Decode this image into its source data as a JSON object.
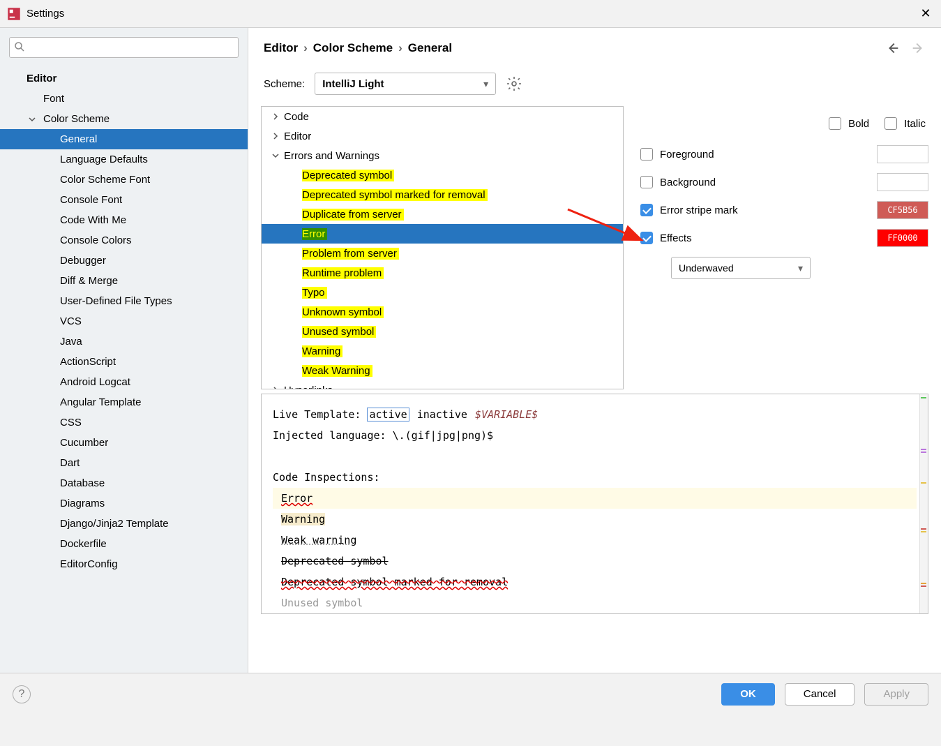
{
  "window": {
    "title": "Settings"
  },
  "breadcrumb": [
    "Editor",
    "Color Scheme",
    "General"
  ],
  "scheme": {
    "label": "Scheme:",
    "value": "IntelliJ Light"
  },
  "sidebar": {
    "root": "Editor",
    "font": "Font",
    "color_scheme": "Color Scheme",
    "items": [
      "General",
      "Language Defaults",
      "Color Scheme Font",
      "Console Font",
      "Code With Me",
      "Console Colors",
      "Debugger",
      "Diff & Merge",
      "User-Defined File Types",
      "VCS",
      "Java",
      "ActionScript",
      "Android Logcat",
      "Angular Template",
      "CSS",
      "Cucumber",
      "Dart",
      "Database",
      "Diagrams",
      "Django/Jinja2 Template",
      "Dockerfile",
      "EditorConfig"
    ],
    "selected": "General"
  },
  "tree": {
    "top": [
      "Code",
      "Editor"
    ],
    "group": "Errors and Warnings",
    "children": [
      "Deprecated symbol",
      "Deprecated symbol marked for removal",
      "Duplicate from server",
      "Error",
      "Problem from server",
      "Runtime problem",
      "Typo",
      "Unknown symbol",
      "Unused symbol",
      "Warning",
      "Weak Warning"
    ],
    "selected": "Error",
    "after": "Hyperlinks"
  },
  "opts": {
    "bold": "Bold",
    "italic": "Italic",
    "foreground": {
      "label": "Foreground",
      "checked": false,
      "color": ""
    },
    "background": {
      "label": "Background",
      "checked": false,
      "color": ""
    },
    "stripe": {
      "label": "Error stripe mark",
      "checked": true,
      "color": "CF5B56"
    },
    "effects": {
      "label": "Effects",
      "checked": true,
      "color": "FF0000",
      "type": "Underwaved"
    }
  },
  "preview": {
    "l1_a": "Live Template: ",
    "l1_active": "active",
    "l1_inactive": "inactive",
    "l1_var": "$VARIABLE$",
    "l2": "Injected language: \\.(gif|jpg|png)$",
    "l3": "Code Inspections:",
    "l4": "Error",
    "l5": "Warning",
    "l6": "Weak warning",
    "l7": "Deprecated symbol",
    "l8": "Deprecated symbol marked for removal",
    "l9": "Unused symbol"
  },
  "footer": {
    "ok": "OK",
    "cancel": "Cancel",
    "apply": "Apply"
  }
}
